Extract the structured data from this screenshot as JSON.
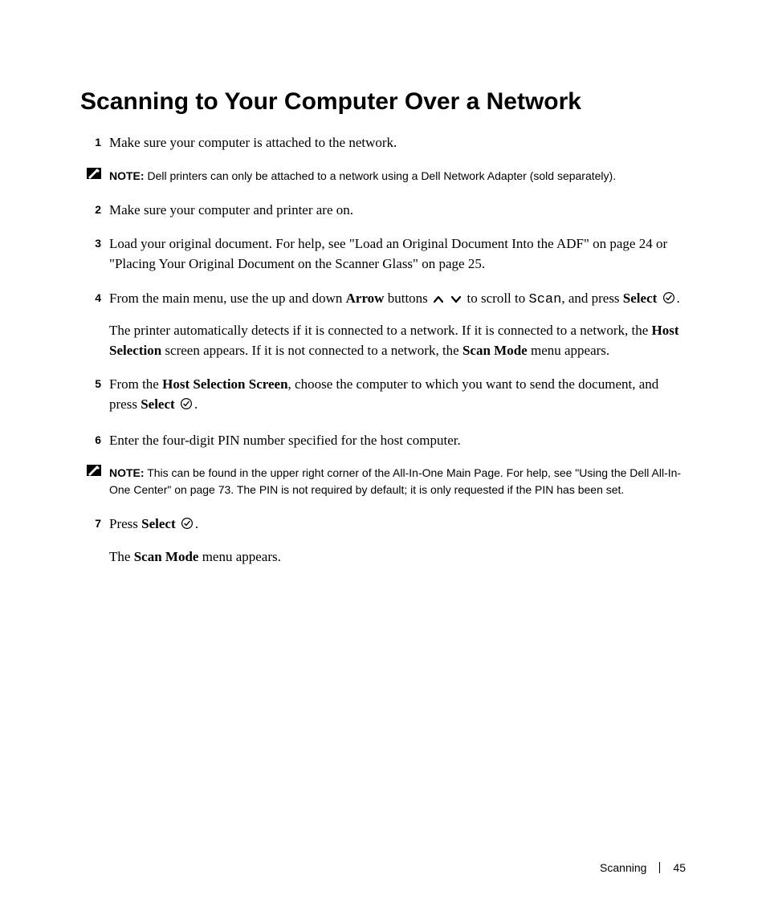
{
  "heading": "Scanning to Your Computer Over a Network",
  "steps": {
    "s1": {
      "num": "1",
      "text": "Make sure your computer is attached to the network."
    },
    "s2": {
      "num": "2",
      "text": "Make sure your computer and printer are on."
    },
    "s3": {
      "num": "3",
      "text": "Load your original document. For help, see \"Load an Original Document Into the ADF\" on page 24 or \"Placing Your Original Document on the Scanner Glass\" on page 25."
    },
    "s4": {
      "num": "4",
      "part_a": "From the main menu, use the up and down ",
      "arrow_word": "Arrow",
      "part_b": " buttons ",
      "part_c": " to scroll to ",
      "scan_word": "Scan",
      "part_d": ", and press ",
      "select_word": "Select",
      "period": ".",
      "para2_a": "The printer automatically detects if it is connected to a network. If it is connected to a network, the ",
      "hostsel": "Host Selection",
      "para2_b": " screen appears. If it is not connected to a network, the ",
      "scanmode": "Scan Mode",
      "para2_c": " menu appears."
    },
    "s5": {
      "num": "5",
      "part_a": "From the ",
      "hss": "Host Selection Screen",
      "part_b": ", choose the computer to which you want to send the document, and press ",
      "select_word": "Select",
      "period": "."
    },
    "s6": {
      "num": "6",
      "text": "Enter the four-digit PIN number specified for the host computer."
    },
    "s7": {
      "num": "7",
      "part_a": "Press ",
      "select_word": "Select",
      "period": ".",
      "para2_a": "The ",
      "scanmode": "Scan Mode",
      "para2_b": " menu appears."
    }
  },
  "notes": {
    "n1": {
      "label": "NOTE:",
      "text": " Dell printers can only be attached to a network using a Dell Network Adapter (sold separately)."
    },
    "n2": {
      "label": "NOTE:",
      "text": " This can be found in the upper right corner of the All-In-One Main Page. For help, see \"Using the Dell All-In-One Center\" on page 73. The PIN is not required by default; it is only requested if the PIN has been set."
    }
  },
  "footer": {
    "section": "Scanning",
    "page": "45"
  },
  "icons": {
    "arrow_up": "arrow-up-icon",
    "arrow_down": "arrow-down-icon",
    "select_circle": "select-check-icon",
    "note_pencil": "note-pencil-icon"
  }
}
